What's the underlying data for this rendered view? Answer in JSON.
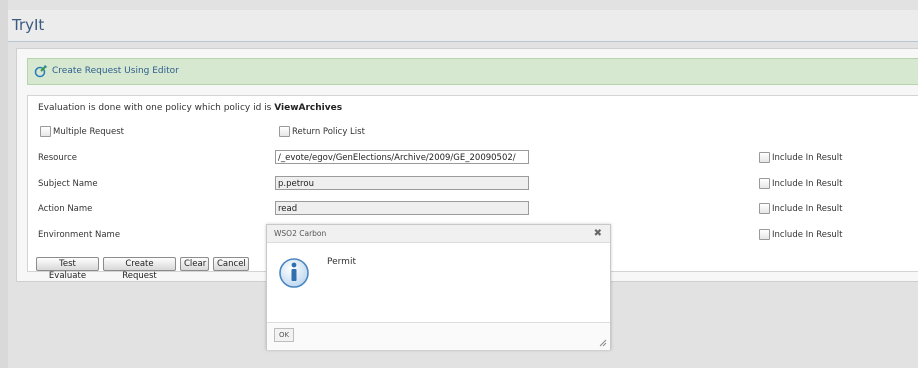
{
  "page": {
    "title": "TryIt"
  },
  "panel": {
    "header": "Create Request Using Editor",
    "evaluation_prefix": "Evaluation is done with one policy which policy id is ",
    "policy_id": "ViewArchives",
    "multiple_request_label": "Multiple Request",
    "return_policy_list_label": "Return Policy List",
    "rows": [
      {
        "label": "Resource",
        "value": "/_evote/egov/GenElections/Archive/2009/GE_20090502/",
        "include_label": "Include In Result"
      },
      {
        "label": "Subject Name",
        "value": "p.petrou",
        "include_label": "Include In Result"
      },
      {
        "label": "Action Name",
        "value": "read",
        "include_label": "Include In Result"
      },
      {
        "label": "Environment Name",
        "value": "",
        "include_label": "Include In Result"
      }
    ],
    "buttons": {
      "test_evaluate": "Test Evaluate",
      "create_request": "Create Request",
      "clear": "Clear",
      "cancel": "Cancel"
    }
  },
  "dialog": {
    "title": "WSO2 Carbon",
    "close_symbol": "✖",
    "message": "Permit",
    "ok_label": "OK"
  },
  "colors": {
    "accent_title": "#3a5a80",
    "header_green": "#d6e8d0",
    "link_blue": "#2f5f8f"
  },
  "icons": [
    "edit-request-icon",
    "info-icon",
    "close-icon",
    "resize-grip-icon"
  ]
}
